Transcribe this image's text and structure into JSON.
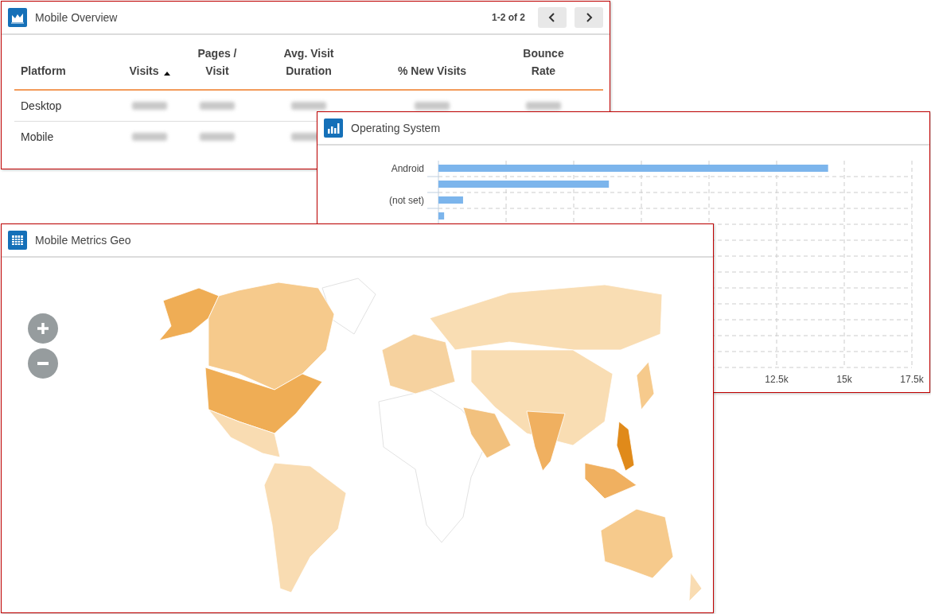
{
  "overview": {
    "title": "Mobile Overview",
    "pager": "1-2 of 2",
    "columns": [
      {
        "label": "Platform",
        "sorted": false
      },
      {
        "label": "Visits",
        "sorted": true
      },
      {
        "label": "Pages / Visit",
        "sorted": false
      },
      {
        "label": "Avg. Visit Duration",
        "sorted": false
      },
      {
        "label": "% New Visits",
        "sorted": false
      },
      {
        "label": "Bounce Rate",
        "sorted": false
      }
    ],
    "rows": [
      {
        "platform": "Desktop"
      },
      {
        "platform": "Mobile"
      }
    ]
  },
  "os": {
    "title": "Operating System",
    "category_labels": [
      "Android",
      "(not set)"
    ],
    "tick_labels": [
      "12.5k",
      "15k",
      "17.5k"
    ]
  },
  "geo": {
    "title": "Mobile Metrics Geo"
  }
}
